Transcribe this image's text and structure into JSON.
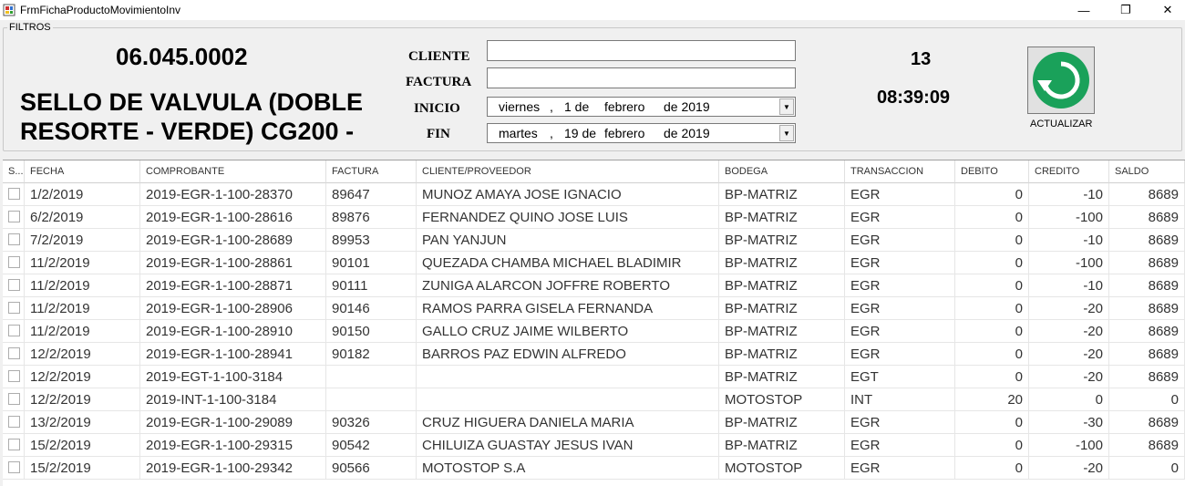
{
  "window": {
    "title": "FrmFichaProductoMovimientoInv",
    "minimize": "—",
    "maximize": "❐",
    "close": "✕"
  },
  "filters": {
    "legend": "FILTROS",
    "codigo": "06.045.0002",
    "descripcion": "SELLO DE VALVULA (DOBLE RESORTE - VERDE) CG200 -",
    "cliente_label": "CLIENTE",
    "factura_label": "FACTURA",
    "inicio_label": "INICIO",
    "fin_label": "FIN",
    "cliente_value": "",
    "factura_value": "",
    "inicio": {
      "day": "viernes",
      "num": "1 de",
      "month": "febrero",
      "year": "de 2019"
    },
    "fin": {
      "day": "martes",
      "num": "19 de",
      "month": "febrero",
      "year": "de 2019"
    },
    "count": "13",
    "clock": "08:39:09",
    "refresh_label": "ACTUALIZAR"
  },
  "colors": {
    "refresh_green": "#1aa15a",
    "grid_border": "#e6e6e6"
  },
  "grid": {
    "headers": [
      "S...",
      "FECHA",
      "COMPROBANTE",
      "FACTURA",
      "CLIENTE/PROVEEDOR",
      "BODEGA",
      "TRANSACCION",
      "DEBITO",
      "CREDITO",
      "SALDO"
    ],
    "rows": [
      [
        "1/2/2019",
        "2019-EGR-1-100-28370",
        "89647",
        "MUNOZ AMAYA JOSE IGNACIO",
        "BP-MATRIZ",
        "EGR",
        "0",
        "-10",
        "8689"
      ],
      [
        "6/2/2019",
        "2019-EGR-1-100-28616",
        "89876",
        "FERNANDEZ QUINO JOSE LUIS",
        "BP-MATRIZ",
        "EGR",
        "0",
        "-100",
        "8689"
      ],
      [
        "7/2/2019",
        "2019-EGR-1-100-28689",
        "89953",
        "PAN YANJUN",
        "BP-MATRIZ",
        "EGR",
        "0",
        "-10",
        "8689"
      ],
      [
        "11/2/2019",
        "2019-EGR-1-100-28861",
        "90101",
        "QUEZADA CHAMBA MICHAEL BLADIMIR",
        "BP-MATRIZ",
        "EGR",
        "0",
        "-100",
        "8689"
      ],
      [
        "11/2/2019",
        "2019-EGR-1-100-28871",
        "90111",
        "ZUNIGA ALARCON JOFFRE ROBERTO",
        "BP-MATRIZ",
        "EGR",
        "0",
        "-10",
        "8689"
      ],
      [
        "11/2/2019",
        "2019-EGR-1-100-28906",
        "90146",
        "RAMOS PARRA GISELA FERNANDA",
        "BP-MATRIZ",
        "EGR",
        "0",
        "-20",
        "8689"
      ],
      [
        "11/2/2019",
        "2019-EGR-1-100-28910",
        "90150",
        "GALLO CRUZ JAIME WILBERTO",
        "BP-MATRIZ",
        "EGR",
        "0",
        "-20",
        "8689"
      ],
      [
        "12/2/2019",
        "2019-EGR-1-100-28941",
        "90182",
        "BARROS PAZ EDWIN ALFREDO",
        "BP-MATRIZ",
        "EGR",
        "0",
        "-20",
        "8689"
      ],
      [
        "12/2/2019",
        "2019-EGT-1-100-3184",
        "",
        "",
        "BP-MATRIZ",
        "EGT",
        "0",
        "-20",
        "8689"
      ],
      [
        "12/2/2019",
        "2019-INT-1-100-3184",
        "",
        "",
        "MOTOSTOP",
        "INT",
        "20",
        "0",
        "0"
      ],
      [
        "13/2/2019",
        "2019-EGR-1-100-29089",
        "90326",
        "CRUZ HIGUERA DANIELA MARIA",
        "BP-MATRIZ",
        "EGR",
        "0",
        "-30",
        "8689"
      ],
      [
        "15/2/2019",
        "2019-EGR-1-100-29315",
        "90542",
        "CHILUIZA GUASTAY JESUS IVAN",
        "BP-MATRIZ",
        "EGR",
        "0",
        "-100",
        "8689"
      ],
      [
        "15/2/2019",
        "2019-EGR-1-100-29342",
        "90566",
        "MOTOSTOP S.A",
        "MOTOSTOP",
        "EGR",
        "0",
        "-20",
        "0"
      ]
    ]
  }
}
